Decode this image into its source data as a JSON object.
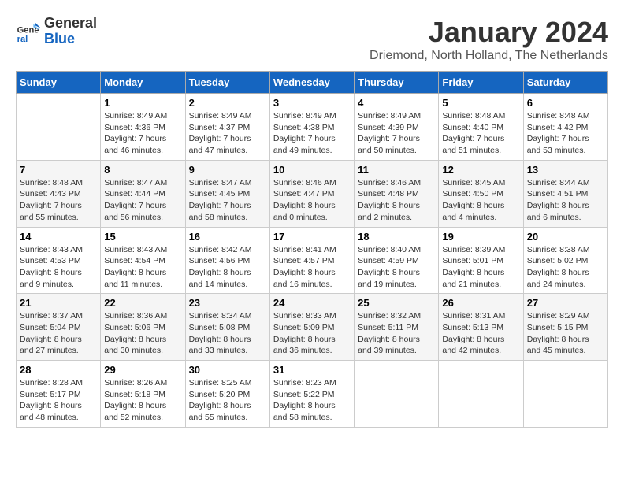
{
  "header": {
    "logo_general": "General",
    "logo_blue": "Blue",
    "month_title": "January 2024",
    "location": "Driemond, North Holland, The Netherlands"
  },
  "calendar": {
    "days_of_week": [
      "Sunday",
      "Monday",
      "Tuesday",
      "Wednesday",
      "Thursday",
      "Friday",
      "Saturday"
    ],
    "weeks": [
      [
        {
          "day": "",
          "info": ""
        },
        {
          "day": "1",
          "info": "Sunrise: 8:49 AM\nSunset: 4:36 PM\nDaylight: 7 hours\nand 46 minutes."
        },
        {
          "day": "2",
          "info": "Sunrise: 8:49 AM\nSunset: 4:37 PM\nDaylight: 7 hours\nand 47 minutes."
        },
        {
          "day": "3",
          "info": "Sunrise: 8:49 AM\nSunset: 4:38 PM\nDaylight: 7 hours\nand 49 minutes."
        },
        {
          "day": "4",
          "info": "Sunrise: 8:49 AM\nSunset: 4:39 PM\nDaylight: 7 hours\nand 50 minutes."
        },
        {
          "day": "5",
          "info": "Sunrise: 8:48 AM\nSunset: 4:40 PM\nDaylight: 7 hours\nand 51 minutes."
        },
        {
          "day": "6",
          "info": "Sunrise: 8:48 AM\nSunset: 4:42 PM\nDaylight: 7 hours\nand 53 minutes."
        }
      ],
      [
        {
          "day": "7",
          "info": "Sunrise: 8:48 AM\nSunset: 4:43 PM\nDaylight: 7 hours\nand 55 minutes."
        },
        {
          "day": "8",
          "info": "Sunrise: 8:47 AM\nSunset: 4:44 PM\nDaylight: 7 hours\nand 56 minutes."
        },
        {
          "day": "9",
          "info": "Sunrise: 8:47 AM\nSunset: 4:45 PM\nDaylight: 7 hours\nand 58 minutes."
        },
        {
          "day": "10",
          "info": "Sunrise: 8:46 AM\nSunset: 4:47 PM\nDaylight: 8 hours\nand 0 minutes."
        },
        {
          "day": "11",
          "info": "Sunrise: 8:46 AM\nSunset: 4:48 PM\nDaylight: 8 hours\nand 2 minutes."
        },
        {
          "day": "12",
          "info": "Sunrise: 8:45 AM\nSunset: 4:50 PM\nDaylight: 8 hours\nand 4 minutes."
        },
        {
          "day": "13",
          "info": "Sunrise: 8:44 AM\nSunset: 4:51 PM\nDaylight: 8 hours\nand 6 minutes."
        }
      ],
      [
        {
          "day": "14",
          "info": "Sunrise: 8:43 AM\nSunset: 4:53 PM\nDaylight: 8 hours\nand 9 minutes."
        },
        {
          "day": "15",
          "info": "Sunrise: 8:43 AM\nSunset: 4:54 PM\nDaylight: 8 hours\nand 11 minutes."
        },
        {
          "day": "16",
          "info": "Sunrise: 8:42 AM\nSunset: 4:56 PM\nDaylight: 8 hours\nand 14 minutes."
        },
        {
          "day": "17",
          "info": "Sunrise: 8:41 AM\nSunset: 4:57 PM\nDaylight: 8 hours\nand 16 minutes."
        },
        {
          "day": "18",
          "info": "Sunrise: 8:40 AM\nSunset: 4:59 PM\nDaylight: 8 hours\nand 19 minutes."
        },
        {
          "day": "19",
          "info": "Sunrise: 8:39 AM\nSunset: 5:01 PM\nDaylight: 8 hours\nand 21 minutes."
        },
        {
          "day": "20",
          "info": "Sunrise: 8:38 AM\nSunset: 5:02 PM\nDaylight: 8 hours\nand 24 minutes."
        }
      ],
      [
        {
          "day": "21",
          "info": "Sunrise: 8:37 AM\nSunset: 5:04 PM\nDaylight: 8 hours\nand 27 minutes."
        },
        {
          "day": "22",
          "info": "Sunrise: 8:36 AM\nSunset: 5:06 PM\nDaylight: 8 hours\nand 30 minutes."
        },
        {
          "day": "23",
          "info": "Sunrise: 8:34 AM\nSunset: 5:08 PM\nDaylight: 8 hours\nand 33 minutes."
        },
        {
          "day": "24",
          "info": "Sunrise: 8:33 AM\nSunset: 5:09 PM\nDaylight: 8 hours\nand 36 minutes."
        },
        {
          "day": "25",
          "info": "Sunrise: 8:32 AM\nSunset: 5:11 PM\nDaylight: 8 hours\nand 39 minutes."
        },
        {
          "day": "26",
          "info": "Sunrise: 8:31 AM\nSunset: 5:13 PM\nDaylight: 8 hours\nand 42 minutes."
        },
        {
          "day": "27",
          "info": "Sunrise: 8:29 AM\nSunset: 5:15 PM\nDaylight: 8 hours\nand 45 minutes."
        }
      ],
      [
        {
          "day": "28",
          "info": "Sunrise: 8:28 AM\nSunset: 5:17 PM\nDaylight: 8 hours\nand 48 minutes."
        },
        {
          "day": "29",
          "info": "Sunrise: 8:26 AM\nSunset: 5:18 PM\nDaylight: 8 hours\nand 52 minutes."
        },
        {
          "day": "30",
          "info": "Sunrise: 8:25 AM\nSunset: 5:20 PM\nDaylight: 8 hours\nand 55 minutes."
        },
        {
          "day": "31",
          "info": "Sunrise: 8:23 AM\nSunset: 5:22 PM\nDaylight: 8 hours\nand 58 minutes."
        },
        {
          "day": "",
          "info": ""
        },
        {
          "day": "",
          "info": ""
        },
        {
          "day": "",
          "info": ""
        }
      ]
    ]
  }
}
